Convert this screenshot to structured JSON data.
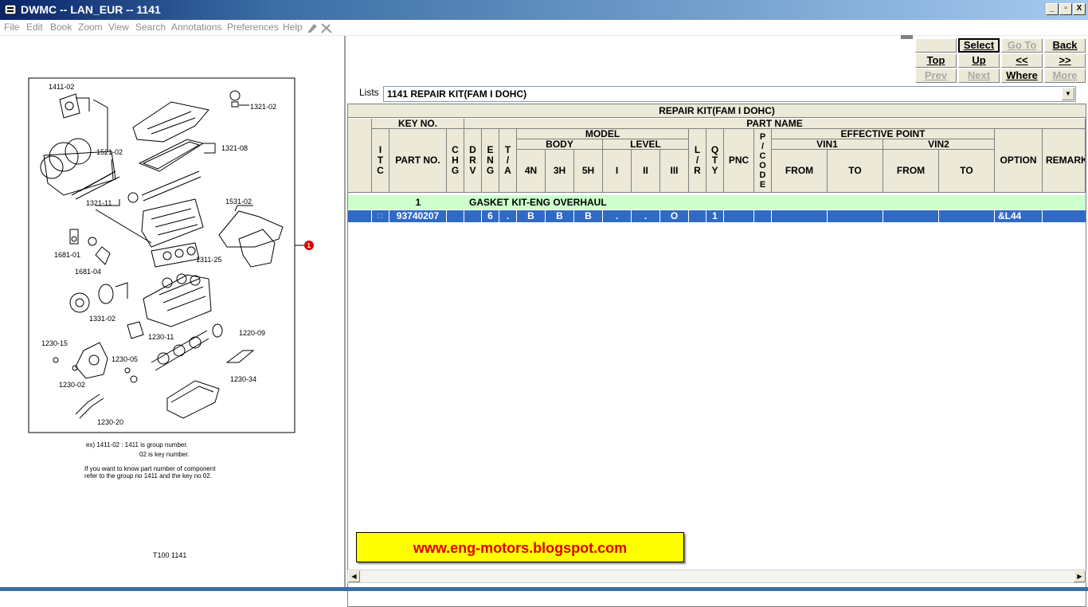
{
  "window": {
    "title": "DWMC -- LAN_EUR -- 1141",
    "buttons": {
      "minimize": "_",
      "restore": "▫",
      "close": "X"
    }
  },
  "menu": [
    "File",
    "Edit",
    "Book",
    "Zoom",
    "View",
    "Search",
    "Annotations",
    "Preferences",
    "Help"
  ],
  "nav": {
    "select": "Select",
    "goto": "Go To",
    "back": "Back",
    "top": "Top",
    "up": "Up",
    "prev_page": "<<",
    "next_page": ">>",
    "prev": "Prev",
    "next": "Next",
    "where": "Where",
    "more": "More"
  },
  "lists": {
    "label": "Lists",
    "value": "1141 REPAIR KIT(FAM I DOHC)"
  },
  "table": {
    "title": "REPAIR KIT(FAM I DOHC)",
    "headers": {
      "key_no": "KEY NO.",
      "part_name": "PART NAME",
      "itc": "I\nT\nC",
      "part_no": "PART NO.",
      "chg": "C\nH\nG",
      "drv": "D\nR\nV",
      "eng": "E\nN\nG",
      "ta": "T\n/\nA",
      "model": "MODEL",
      "body": "BODY",
      "level": "LEVEL",
      "n4": "4N",
      "h3": "3H",
      "h5": "5H",
      "l1": "I",
      "l2": "II",
      "l3": "III",
      "lr": "L\n/\nR",
      "qty": "Q\nT\nY",
      "pnc": "PNC",
      "pcode": "P\n/\nC\nO\nD\nE",
      "effective_point": "EFFECTIVE POINT",
      "vin1": "VIN1",
      "vin2": "VIN2",
      "from": "FROM",
      "to": "TO",
      "option": "OPTION",
      "remark": "REMARK"
    },
    "group_row": {
      "key": "1",
      "name": "GASKET KIT-ENG OVERHAUL"
    },
    "part_row": {
      "itc": "□",
      "part_no": "93740207",
      "chg": "",
      "drv": "",
      "eng": "6",
      "ta": ".",
      "n4": "B",
      "h3": "B",
      "h5": "B",
      "l1": ".",
      "l2": ".",
      "l3": "O",
      "lr": "",
      "qty": "1",
      "pnc": "",
      "pcode": "",
      "vin1_from": "",
      "vin1_to": "",
      "vin2_from": "",
      "vin2_to": "",
      "option": "&L44",
      "remark": ""
    }
  },
  "diagram": {
    "labels": [
      "1411-02",
      "1321-02",
      "1321-08",
      "1521-02",
      "1321-11",
      "1531-02",
      "1681-01",
      "1681-04",
      "1311-25",
      "1331-02",
      "1220-09",
      "1230-15",
      "1230-11",
      "1230-05",
      "1230-02",
      "1230-34",
      "1230-20"
    ],
    "callout": "1",
    "note1": "ex) 1411-02 : 1411 is group number.",
    "note2": "02 is key number.",
    "note3": "If you want to know  part number of component",
    "note4": "refer to the group no  1411 and the key no 02.",
    "page_id": "T100  1141"
  },
  "banner": "www.eng-motors.blogspot.com",
  "colors": {
    "group_row": "#ccffcc",
    "selected_row": "#316ac5",
    "header_bg": "#ece9d8",
    "banner": "#ffff00",
    "banner_text": "#e00000"
  }
}
